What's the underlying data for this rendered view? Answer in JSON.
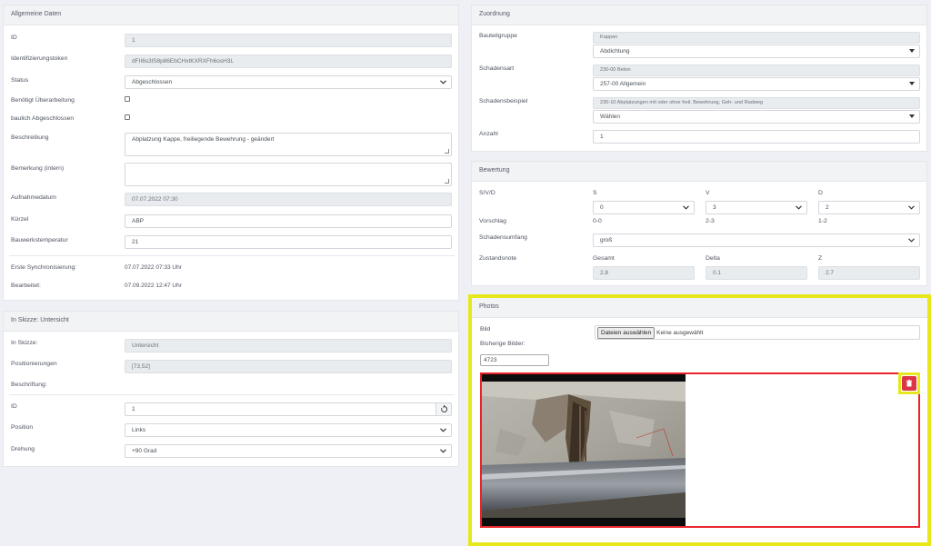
{
  "allgemein": {
    "title": "Allgemeine Daten",
    "id_label": "ID",
    "id_value": "1",
    "token_label": "Identifizierungstoken",
    "token_value": "dFII6s3lS8p86EbCHxtKXRXFh6osH3L",
    "status_label": "Status",
    "status_value": "Abgeschlossen",
    "ueberarbeitung_label": "Benötigt Überarbeitung",
    "baulich_label": "baulich Abgeschlossen",
    "beschreibung_label": "Beschreibung",
    "beschreibung_value": "Abplatzung Kappe, freiliegende Bewehrung - geändert",
    "bemerkung_label": "Bemerkung (intern)",
    "bemerkung_value": "",
    "aufnahmedatum_label": "Aufnahmedatum",
    "aufnahmedatum_value": "07.07.2022 07:30",
    "kuerzel_label": "Kürzel",
    "kuerzel_value": "ABP",
    "temperatur_label": "Bauwerkstemperatur",
    "temperatur_value": "21",
    "sync_label": "Erste Synchronisierung:",
    "sync_value": "07.07.2022 07:33 Uhr",
    "bearbeitet_label": "Bearbeitet:",
    "bearbeitet_value": "07.09.2022 12:47 Uhr"
  },
  "skizze": {
    "title": "In Skizze: Untersicht",
    "in_skizze_label": "In Skizze:",
    "in_skizze_value": "Untersicht",
    "positionierungen_label": "Positionierungen",
    "positionierungen_value": "[73,52]",
    "beschriftung_label": "Beschriftung:",
    "id_label": "ID",
    "id_value": "1",
    "position_label": "Position",
    "position_value": "Links",
    "drehung_label": "Drehung",
    "drehung_value": "+90 Grad"
  },
  "zuordnung": {
    "title": "Zuordnung",
    "bauteilgruppe_label": "Bauteilgruppe",
    "bauteilgruppe_ro": "Kappen",
    "bauteilgruppe_value": "Abdichtung",
    "schadensart_label": "Schadensart",
    "schadensart_ro": "230-00 Beton",
    "schadensart_value": "257-00 Allgemein",
    "schadensbeispiel_label": "Schadensbeispiel",
    "schadensbeispiel_ro": "230-10 Abplatzungen mit oder ohne freil. Bewehrung, Geh- und Radweg",
    "schadensbeispiel_value": "Wählen",
    "anzahl_label": "Anzahl",
    "anzahl_value": "1"
  },
  "bewertung": {
    "title": "Bewertung",
    "svd_label": "S/V/D",
    "s_label": "S",
    "v_label": "V",
    "d_label": "D",
    "s_value": "0",
    "v_value": "3",
    "d_value": "2",
    "vorschlag_label": "Vorschlag",
    "vorschlag_s": "0-0",
    "vorschlag_v": "2-3",
    "vorschlag_d": "1-2",
    "umfang_label": "Schadensumfang",
    "umfang_value": "groß",
    "zustandsnote_label": "Zustandsnote",
    "gesamt_label": "Gesamt",
    "delta_label": "Delta",
    "z_label": "Z",
    "gesamt_value": "2.8",
    "delta_value": "0.1",
    "z_value": "2.7"
  },
  "photos": {
    "title": "Photos",
    "bild_label": "Bild",
    "file_button": "Dateien auswählen",
    "file_status": "Keine ausgewählt",
    "bisherige_label": "Bisherige Bilder:",
    "image_id": "4723",
    "delete_icon": "trash-icon"
  },
  "colors": {
    "highlight": "#e6e81c",
    "delete": "#dc3545",
    "photo_border": "#e8242b"
  }
}
